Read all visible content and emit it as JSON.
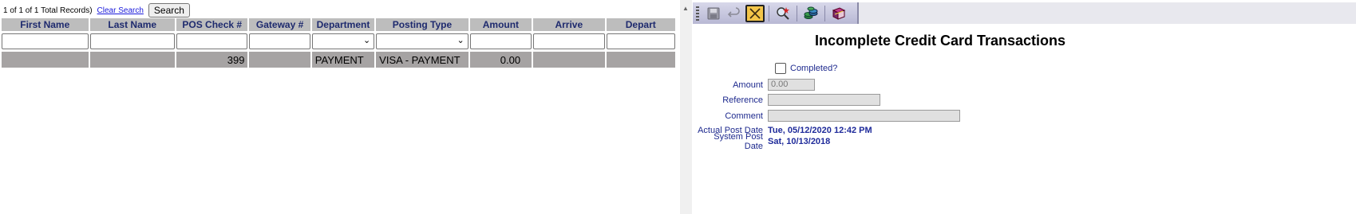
{
  "search_bar": {
    "records_text": "1 of 1 of 1 Total Records)",
    "clear_search_label": "Clear Search",
    "search_button_label": "Search"
  },
  "grid": {
    "columns": [
      "First Name",
      "Last Name",
      "POS Check #",
      "Gateway #",
      "Department",
      "Posting Type",
      "Amount",
      "Arrive",
      "Depart"
    ],
    "rows": [
      {
        "first_name": "",
        "last_name": "",
        "pos_check": "399",
        "gateway": "",
        "department": "PAYMENT",
        "posting_type": "VISA - PAYMENT",
        "amount": "0.00",
        "arrive": "",
        "depart": ""
      }
    ]
  },
  "toolbar": {
    "icons": [
      "save-icon",
      "undo-icon",
      "close-icon",
      "zoom-icon",
      "chips-icon",
      "books-icon"
    ],
    "active_color": "#f3c54a"
  },
  "detail": {
    "title": "Incomplete Credit Card Transactions",
    "completed_label": "Completed?",
    "amount_label": "Amount",
    "amount_value": "0.00",
    "reference_label": "Reference",
    "reference_value": "",
    "comment_label": "Comment",
    "comment_value": "",
    "actual_post_date_label": "Actual Post Date",
    "actual_post_date_value": "Tue, 05/12/2020 12:42 PM",
    "system_post_date_label": "System Post Date",
    "system_post_date_value": "Sat, 10/13/2018"
  },
  "colors": {
    "header_bg": "#bdbdbd",
    "header_text": "#1e2a6e",
    "row_bg": "#a6a3a3",
    "label_text": "#1e2a8e"
  }
}
